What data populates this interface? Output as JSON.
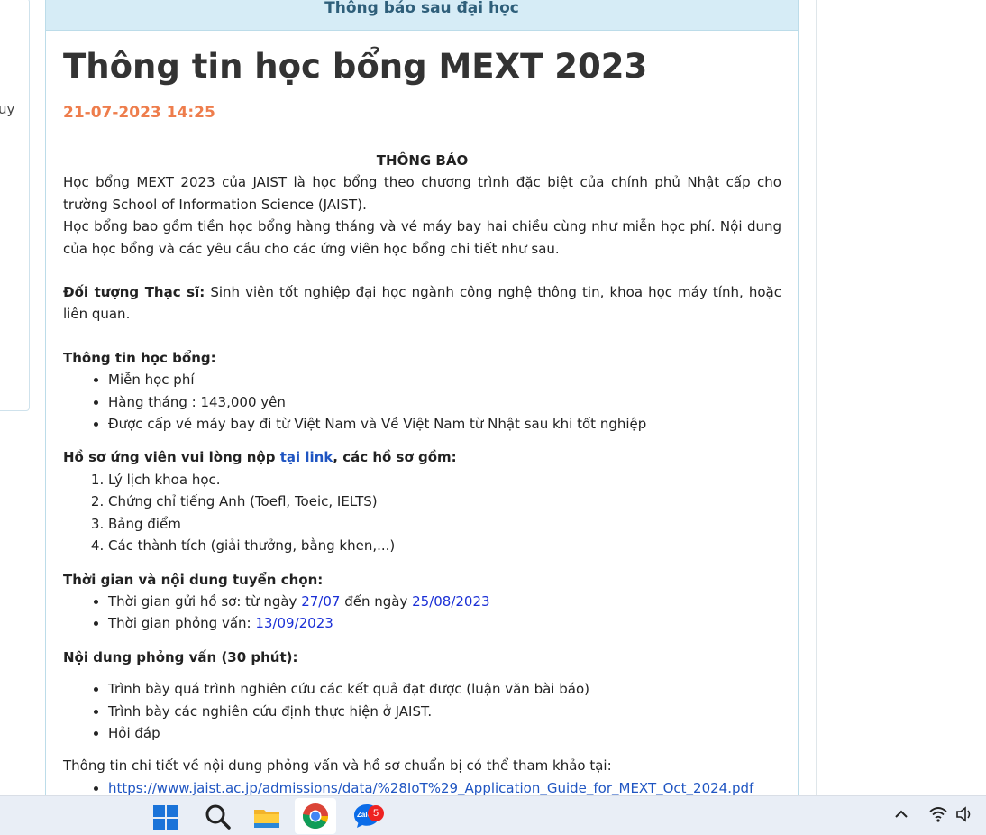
{
  "left_panel": {
    "snippet": "uy"
  },
  "card": {
    "header": "Thông báo sau đại học",
    "title": "Thông tin học bổng MEXT 2023",
    "date": "21-07-2023 14:25",
    "notice_heading": "THÔNG BÁO",
    "intro_1": "Học bổng MEXT 2023 của JAIST là học bổng theo chương trình đặc biệt của chính phủ Nhật cấp cho trường School of Information Science (JAIST).",
    "intro_2": "Học bổng bao gồm tiền học bổng hàng tháng và vé máy bay hai chiều cùng như miễn học phí. Nội dung của học bổng và các yêu cầu cho các ứng viên học bổng chi tiết như sau.",
    "target_label": "Đối tượng Thạc sĩ:",
    "target_text": " Sinh viên tốt nghiệp đại học ngành công nghệ thông tin, khoa học máy tính, hoặc liên quan.",
    "scholarship_title": "Thông tin học bổng:",
    "scholarship_items": [
      "Miễn học phí",
      "Hàng tháng : 143,000 yên",
      "Được cấp vé máy bay đi từ Việt Nam và Về Việt Nam từ Nhật sau khi tốt nghiệp"
    ],
    "docs_title_prefix": "Hồ sơ ứng viên vui lòng nộp ",
    "docs_link": "tại link",
    "docs_title_suffix": ", các hồ sơ gồm:",
    "docs_items": [
      "Lý lịch khoa học.",
      "Chứng chỉ tiếng Anh (Toefl, Toeic, IELTS)",
      "Bảng điểm",
      "Các thành tích (giải thưởng, bằng khen,...)"
    ],
    "schedule_title": "Thời gian và nội dung tuyển chọn:",
    "schedule_1_prefix": "Thời gian gửi hồ sơ: từ ngày ",
    "schedule_1_from": "27/07",
    "schedule_1_mid": " đến ngày ",
    "schedule_1_to": "25/08/2023",
    "schedule_2_prefix": "Thời gian phỏng vấn: ",
    "schedule_2_date": "13/09/2023",
    "interview_title": "Nội dung phỏng vấn",
    "interview_duration": " (30 phút):",
    "interview_items": [
      "Trình bày quá trình nghiên cứu các kết quả đạt được (luận văn bài báo)",
      "Trình bày các nghiên cứu định thực hiện ở JAIST.",
      "Hỏi đáp"
    ],
    "details_text": "Thông tin chi tiết về nội dung phỏng vấn và hồ sơ chuẩn bị có thể tham khảo tại:",
    "detail_links": [
      "https://www.jaist.ac.jp/admissions/data/%28IoT%29_Application_Guide_for_MEXT_Oct_2024.pdf"
    ]
  },
  "taskbar": {
    "icons": [
      "windows-start-icon",
      "search-icon",
      "file-explorer-icon",
      "chrome-icon",
      "zalo-icon"
    ],
    "zalo_label": "Zalo",
    "zalo_badge": "5",
    "tray_icons": [
      "chevron-up-icon",
      "wifi-icon",
      "speaker-icon"
    ]
  },
  "colors": {
    "header_bg": "#d6ecf6",
    "header_text": "#2f5f7a",
    "date": "#ee7d4c",
    "link": "#1f55c2",
    "date_link": "#1a2fd6"
  }
}
